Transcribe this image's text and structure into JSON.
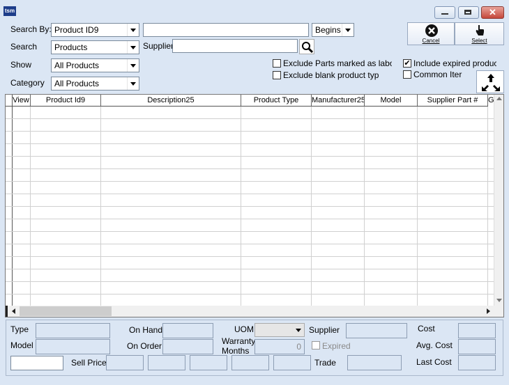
{
  "window": {
    "app_icon": "tsm",
    "controls": [
      "minimize-icon",
      "maximize-icon",
      "close-icon"
    ]
  },
  "search": {
    "search_by_label": "Search By:",
    "search_by_value": "Product ID9",
    "search_query": "",
    "match_mode": "Begins",
    "search_label": "Search",
    "search_value": "Products",
    "supplier_label": "Supplier",
    "supplier_value": "",
    "show_label": "Show",
    "show_value": "All Products",
    "category_label": "Category",
    "category_value": "All Products"
  },
  "options": {
    "exclude_labour": {
      "label": "Exclude Parts marked as labou",
      "checked": false
    },
    "exclude_blank": {
      "label": "Exclude blank product typ",
      "checked": false
    },
    "include_expired": {
      "label": "Include expired produc",
      "checked": true
    },
    "common_items": {
      "label": "Common Iter",
      "checked": false
    }
  },
  "actions": {
    "cancel_label": "Cancel",
    "select_label": "Select"
  },
  "grid": {
    "columns": [
      "View",
      "Product Id9",
      "Description25",
      "Product Type",
      "Manufacturer25",
      "Model",
      "Supplier Part #",
      "G"
    ],
    "rows": []
  },
  "details": {
    "type_label": "Type",
    "model_label": "Model",
    "on_hand_label": "On Hand",
    "on_order_label": "On Order",
    "uom_label": "UOM",
    "warranty_label": "Warranty Months",
    "warranty_value": "0",
    "supplier_label": "Supplier",
    "expired_label": "Expired",
    "trade_label": "Trade",
    "cost_label": "Cost",
    "avg_cost_label": "Avg. Cost",
    "last_cost_label": "Last Cost",
    "sell_price_label": "Sell Price"
  }
}
